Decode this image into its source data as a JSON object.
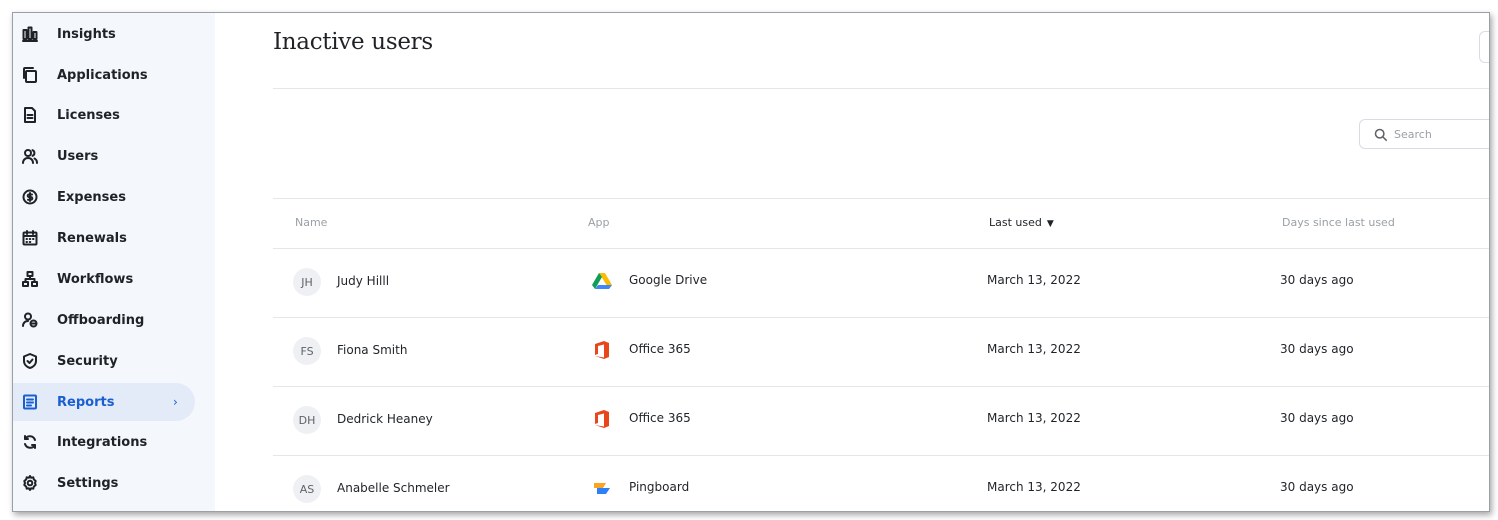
{
  "sidebar": {
    "items": [
      {
        "label": "Insights",
        "icon": "bar-chart-icon"
      },
      {
        "label": "Applications",
        "icon": "copy-icon"
      },
      {
        "label": "Licenses",
        "icon": "document-icon"
      },
      {
        "label": "Users",
        "icon": "users-icon"
      },
      {
        "label": "Expenses",
        "icon": "dollar-circle-icon"
      },
      {
        "label": "Renewals",
        "icon": "calendar-icon"
      },
      {
        "label": "Workflows",
        "icon": "workflow-icon"
      },
      {
        "label": "Offboarding",
        "icon": "user-remove-icon"
      },
      {
        "label": "Security",
        "icon": "shield-icon"
      },
      {
        "label": "Reports",
        "icon": "report-icon",
        "active": true,
        "chevron": "›"
      },
      {
        "label": "Integrations",
        "icon": "sync-icon"
      },
      {
        "label": "Settings",
        "icon": "gear-icon"
      }
    ]
  },
  "header": {
    "title": "Inactive users"
  },
  "search": {
    "placeholder": "Search"
  },
  "table": {
    "columns": {
      "name": "Name",
      "app": "App",
      "last_used": "Last used",
      "days_since": "Days since last used"
    },
    "sort_indicator": "▼",
    "rows": [
      {
        "initials": "JH",
        "name": "Judy Hilll",
        "app": "Google Drive",
        "app_icon": "google-drive-icon",
        "last_used": "March 13, 2022",
        "days_since": "30 days ago"
      },
      {
        "initials": "FS",
        "name": "Fiona Smith",
        "app": "Office 365",
        "app_icon": "office-365-icon",
        "last_used": "March 13, 2022",
        "days_since": "30 days ago"
      },
      {
        "initials": "DH",
        "name": "Dedrick Heaney",
        "app": "Office 365",
        "app_icon": "office-365-icon",
        "last_used": "March 13, 2022",
        "days_since": "30 days ago"
      },
      {
        "initials": "AS",
        "name": "Anabelle Schmeler",
        "app": "Pingboard",
        "app_icon": "pingboard-icon",
        "last_used": "March 13, 2022",
        "days_since": "30 days ago"
      }
    ]
  },
  "colors": {
    "accent": "#1a5fd0",
    "sidebar_bg": "#f4f7fc",
    "active_bg": "#e3ebf8",
    "office_red": "#e8461b"
  }
}
